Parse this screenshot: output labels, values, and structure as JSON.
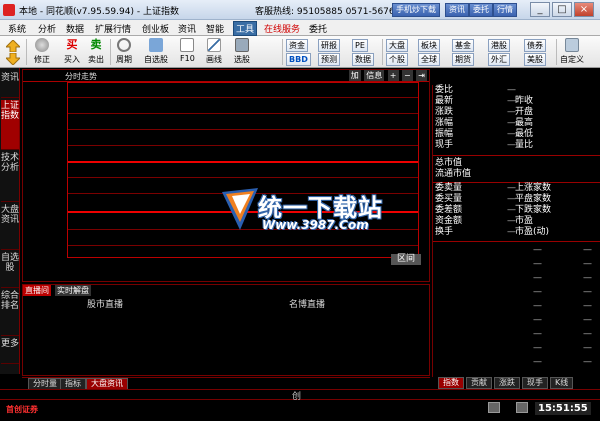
{
  "window": {
    "title": "本地 - 同花顺(v7.95.59.94) - 上证指数",
    "hotline": "客服热线: 95105885  0571-56768888",
    "buttons": [
      "手机炒下载",
      "资讯",
      "委托",
      "行情"
    ],
    "controls": [
      "_",
      "□",
      "×"
    ]
  },
  "menu": [
    "系统",
    "分析",
    "数据",
    "扩展行情",
    "创业板",
    "资讯",
    "智能",
    "工具",
    "在线服务",
    "委托"
  ],
  "menu_active": "工具",
  "menu_red": "在线服务",
  "toolbar": {
    "main": [
      "修正",
      "买入",
      "卖出",
      "周期",
      "自选股",
      "F10",
      "画线",
      "选股"
    ],
    "buy_glyph": "买",
    "sell_glyph": "卖",
    "group1": [
      "资金",
      "研报",
      "PE",
      "BBD",
      "预测",
      "数据"
    ],
    "group2": [
      "大盘",
      "板块",
      "基金",
      "港股",
      "债券",
      "个股",
      "全球",
      "期货",
      "外汇",
      "美股"
    ],
    "custom": "自定义"
  },
  "left_tabs": [
    "资讯",
    "上证指数",
    "技术分析",
    "大盘资讯",
    "自选股",
    "综合排名",
    "更多"
  ],
  "left_active": "上证指数",
  "chart": {
    "label": "分时走势",
    "tools": [
      "加",
      "信息",
      "+",
      "−",
      "⇥"
    ],
    "region": "区间"
  },
  "watermark": {
    "cn": "统一下载站",
    "url": "Www.3987.Com"
  },
  "info": {
    "rows1": [
      {
        "k": "委比",
        "k2": ""
      },
      {
        "k": "最新",
        "k2": "昨收"
      },
      {
        "k": "涨跌",
        "k2": "开盘"
      },
      {
        "k": "涨幅",
        "k2": "最高"
      },
      {
        "k": "振幅",
        "k2": "最低"
      },
      {
        "k": "现手",
        "k2": "量比"
      }
    ],
    "rows2": [
      {
        "k": "总市值",
        "k2": ""
      },
      {
        "k": "流通市值",
        "k2": ""
      }
    ],
    "rows3": [
      {
        "k": "委卖量",
        "k2": "上涨家数"
      },
      {
        "k": "委买量",
        "k2": "平盘家数"
      },
      {
        "k": "委差额",
        "k2": "下跌家数"
      },
      {
        "k": "资金额",
        "k2": "市盈"
      },
      {
        "k": "换手",
        "k2": "市盈(动)"
      }
    ],
    "dash": "—"
  },
  "news": {
    "tabs": [
      "直播间",
      "实时解盘"
    ],
    "col1": "股市直播",
    "col2": "名博直播"
  },
  "bottom_tabs": [
    "分时量",
    "指标",
    "大盘资讯"
  ],
  "bottom_active": "大盘资讯",
  "right_tabs": [
    "指数",
    "贡献",
    "涨跌",
    "现手",
    "K线"
  ],
  "right_active": "指数",
  "status": {
    "chuang": "创",
    "brand": "首创证券",
    "time": "15:51:55"
  }
}
